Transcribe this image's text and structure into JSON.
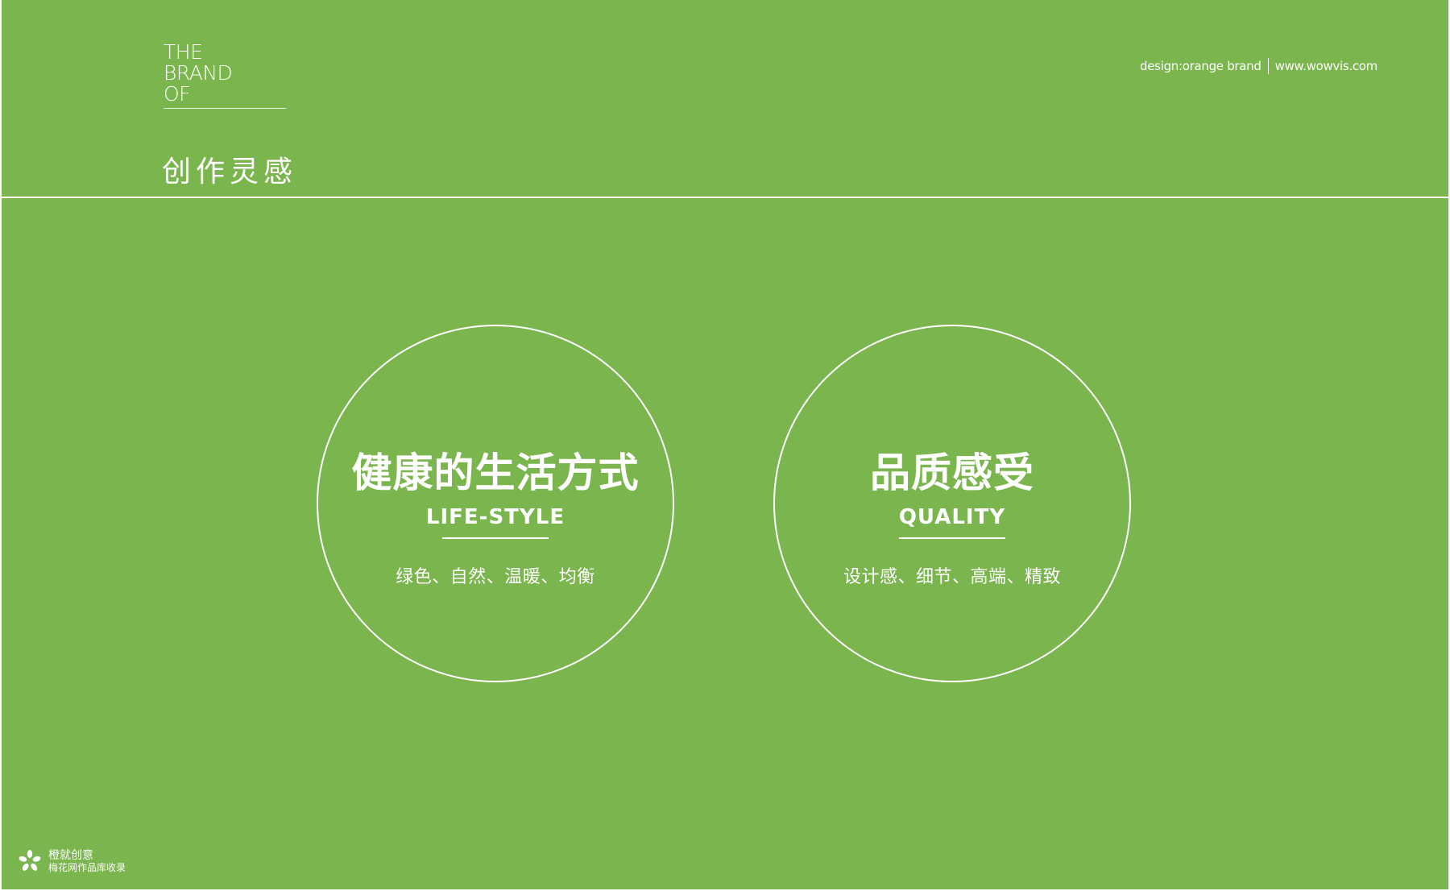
{
  "colors": {
    "background": "#7ab54d",
    "foreground": "#ffffff"
  },
  "brand": {
    "lines": [
      "THE",
      "BRAND",
      "OF"
    ]
  },
  "section_title": "创作灵感",
  "top_credit": {
    "design": "design:orange brand",
    "website": "www.wowvis.com"
  },
  "circles": [
    {
      "title": "健康的生活方式",
      "subtitle": "LIFE-STYLE",
      "description": "绿色、自然、温暖、均衡"
    },
    {
      "title": "品质感受",
      "subtitle": "QUALITY",
      "description": "设计感、细节、高端、精致"
    }
  ],
  "watermark": {
    "icon": "flower-logo-icon",
    "line1": "橙就创意",
    "line2": "梅花网作品库收录"
  }
}
